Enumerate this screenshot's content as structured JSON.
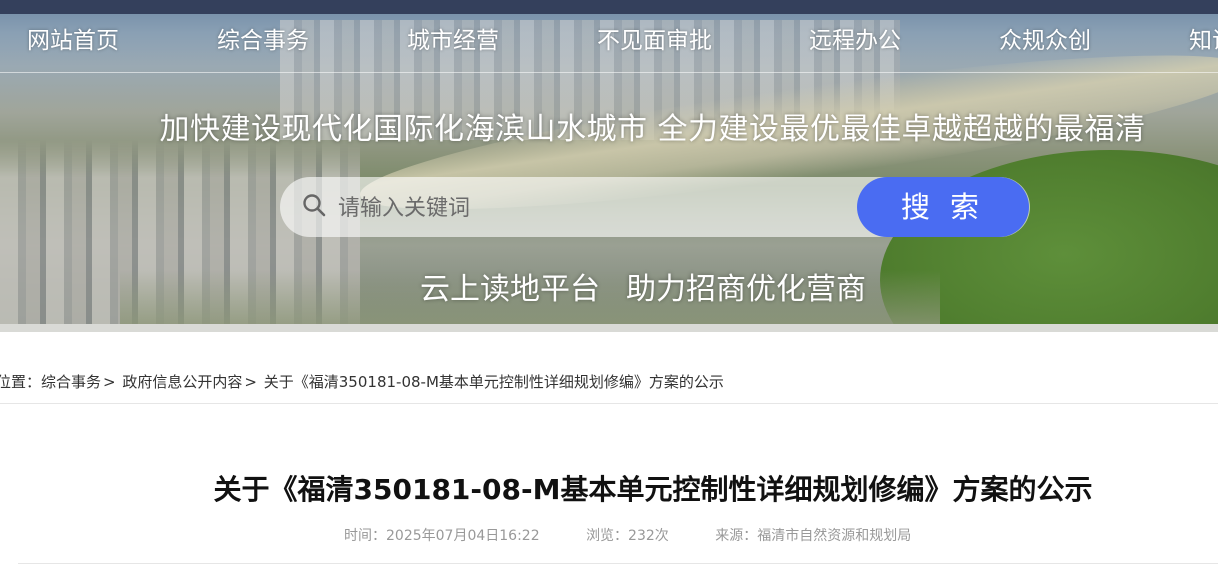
{
  "nav": {
    "items": [
      {
        "label": "网站首页"
      },
      {
        "label": "综合事务"
      },
      {
        "label": "城市经营"
      },
      {
        "label": "不见面审批"
      },
      {
        "label": "远程办公"
      },
      {
        "label": "众规众创"
      },
      {
        "label": "知识"
      }
    ]
  },
  "banner": {
    "slogan": "加快建设现代化国际化海滨山水城市  全力建设最优最佳卓越超越的最福清",
    "sub_slogan_1": "云上读地平台",
    "sub_slogan_2": "助力招商优化营商"
  },
  "search": {
    "placeholder": "请输入关键词",
    "button_label": "搜 索",
    "accent_color": "#4a6cf2"
  },
  "breadcrumb": {
    "prefix": "位置：",
    "items": [
      {
        "label": "综合事务"
      },
      {
        "label": "政府信息公开内容"
      },
      {
        "label": "关于《福清350181-08-M基本单元控制性详细规划修编》方案的公示"
      }
    ],
    "separator": ">"
  },
  "article": {
    "title": "关于《福清350181-08-M基本单元控制性详细规划修编》方案的公示",
    "time": "时间：2025年07月04日16:22",
    "views": "浏览：232次",
    "source": "来源：福清市自然资源和规划局"
  }
}
